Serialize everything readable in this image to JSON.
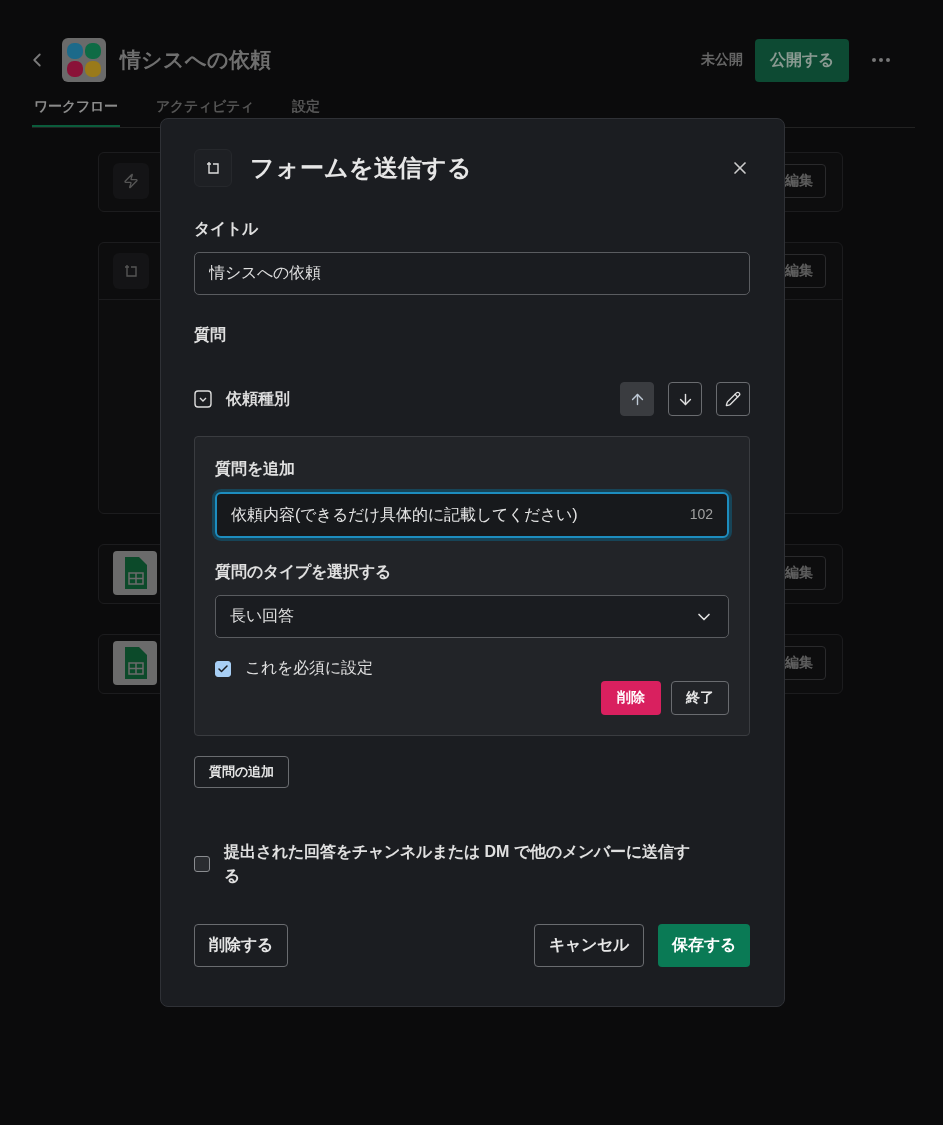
{
  "header": {
    "title": "情シスへの依頼",
    "status": "未公開",
    "publish_button": "公開する"
  },
  "tabs": [
    {
      "label": "ワークフロー",
      "selected": true
    },
    {
      "label": "アクティビティ",
      "selected": false
    },
    {
      "label": "設定",
      "selected": false
    }
  ],
  "steps": [
    {
      "kind": "trigger",
      "edit": "編集"
    },
    {
      "kind": "form",
      "edit": "編集"
    },
    {
      "kind": "sheet",
      "edit": "編集"
    },
    {
      "kind": "sheet",
      "edit": "編集"
    }
  ],
  "dialog": {
    "title": "フォームを送信する",
    "title_label": "タイトル",
    "title_value": "情シスへの依頼",
    "questions_label": "質問",
    "questions": [
      {
        "label": "依頼種別"
      }
    ],
    "move_buttons": [
      {
        "kind": "up",
        "active": true
      },
      {
        "kind": "down",
        "active": false
      },
      {
        "kind": "edit",
        "active": false
      }
    ],
    "editor": {
      "label": "質問を追加",
      "value": "依頼内容(できるだけ具体的に記載してください)",
      "count": "102",
      "type_label": "質問のタイプを選択する",
      "type_value": "長い回答",
      "required": {
        "label": "これを必須に設定",
        "checked": true
      },
      "delete": "削除",
      "done": "終了"
    },
    "add_question": "質問の追加",
    "send_option": {
      "label": "提出された回答をチャンネルまたは DM で他のメンバーに送信する",
      "checked": false
    },
    "footer": {
      "delete": "削除する",
      "cancel": "キャンセル",
      "save": "保存する"
    }
  }
}
